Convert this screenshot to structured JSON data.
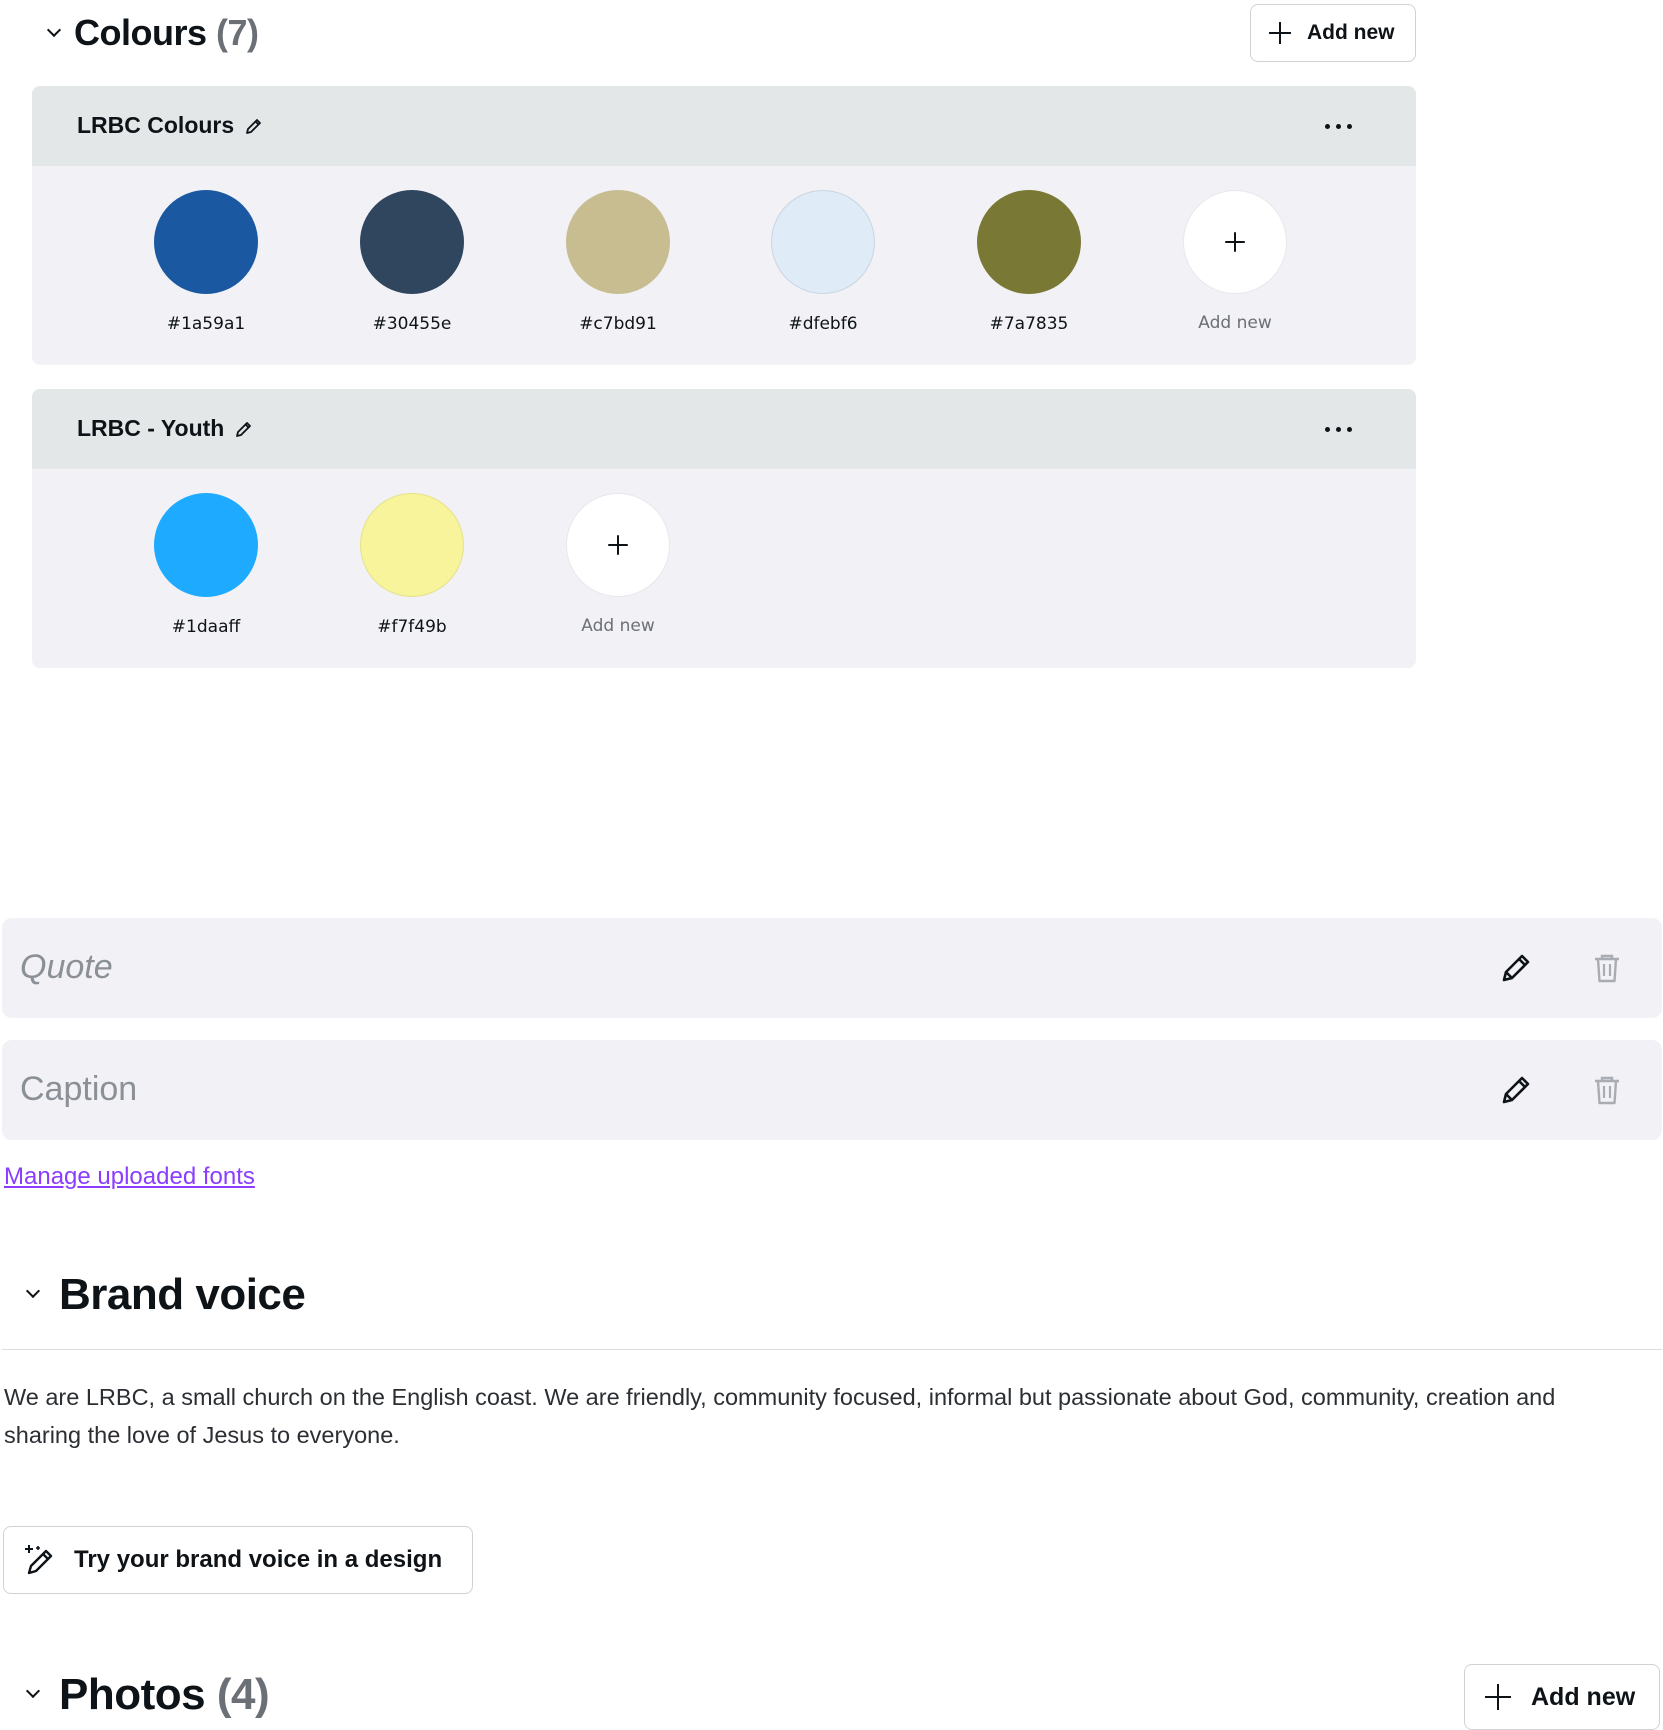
{
  "colours": {
    "title": "Colours",
    "count": "(7)",
    "add_new_label": "Add new",
    "palettes": [
      {
        "name": "LRBC Colours",
        "swatches": [
          {
            "hex": "#1a59a1",
            "label": "#1a59a1"
          },
          {
            "hex": "#30455e",
            "label": "#30455e"
          },
          {
            "hex": "#c7bd91",
            "label": "#c7bd91"
          },
          {
            "hex": "#dfebf6",
            "label": "#dfebf6"
          },
          {
            "hex": "#7a7835",
            "label": "#7a7835"
          }
        ],
        "add_label": "Add new"
      },
      {
        "name": "LRBC - Youth",
        "swatches": [
          {
            "hex": "#1daaff",
            "label": "#1daaff"
          },
          {
            "hex": "#f7f49b",
            "label": "#f7f49b"
          }
        ],
        "add_label": "Add new"
      }
    ]
  },
  "fonts": {
    "rows": [
      {
        "sample": "Quote"
      },
      {
        "sample": "Caption"
      }
    ],
    "manage_link": "Manage uploaded fonts"
  },
  "brand_voice": {
    "title": "Brand voice",
    "text": "We are LRBC, a small church on the English coast.  We are friendly, community  focused, informal but passionate about God, community, creation and sharing the love of Jesus to everyone.",
    "try_button": "Try your brand voice in a design"
  },
  "photos": {
    "title": "Photos",
    "count": "(4)",
    "add_new_label": "Add new"
  },
  "icons": {
    "chevron": "chevron-down-icon",
    "plus": "plus-icon",
    "edit": "pencil-icon",
    "more": "more-dots-icon",
    "delete": "trash-icon",
    "magic": "magic-pencil-icon"
  }
}
